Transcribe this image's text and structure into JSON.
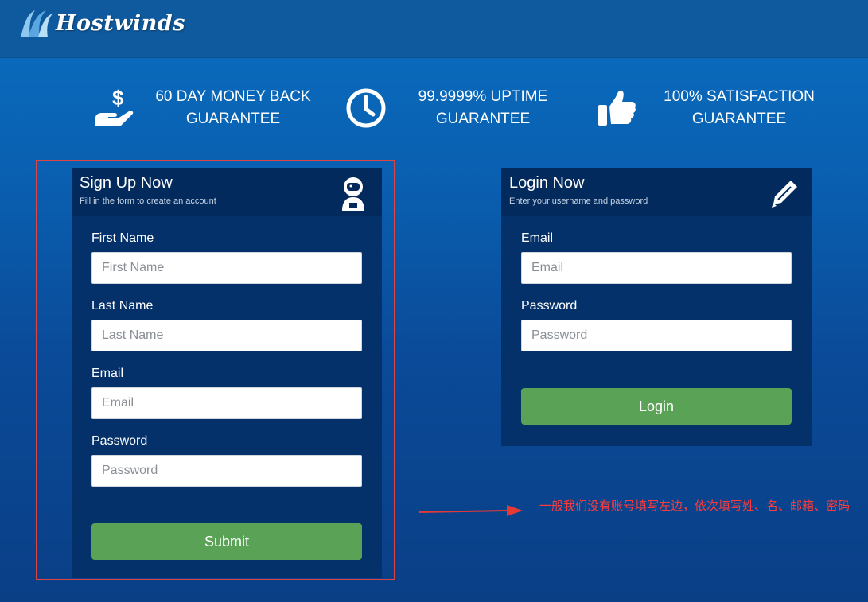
{
  "brand": {
    "name": "Hostwinds"
  },
  "features": [
    {
      "icon": "hand-dollar-icon",
      "line1": "60 DAY MONEY BACK",
      "line2": "GUARANTEE"
    },
    {
      "icon": "clock-icon",
      "line1": "99.9999% UPTIME",
      "line2": "GUARANTEE"
    },
    {
      "icon": "thumbs-up-icon",
      "line1": "100% SATISFACTION",
      "line2": "GUARANTEE"
    }
  ],
  "signup": {
    "title": "Sign Up Now",
    "subtitle": "Fill in the form to create an account",
    "icon": "astronaut-icon",
    "fields": {
      "first_name": {
        "label": "First Name",
        "placeholder": "First Name",
        "value": ""
      },
      "last_name": {
        "label": "Last Name",
        "placeholder": "Last Name",
        "value": ""
      },
      "email": {
        "label": "Email",
        "placeholder": "Email",
        "value": ""
      },
      "password": {
        "label": "Password",
        "placeholder": "Password",
        "value": ""
      }
    },
    "submit_label": "Submit"
  },
  "login": {
    "title": "Login Now",
    "subtitle": "Enter your username and password",
    "icon": "pencil-icon",
    "fields": {
      "email": {
        "label": "Email",
        "placeholder": "Email",
        "value": ""
      },
      "password": {
        "label": "Password",
        "placeholder": "Password",
        "value": ""
      }
    },
    "submit_label": "Login"
  },
  "annotation": {
    "text": "一般我们没有账号填写左边，依次填写姓、名、邮箱、密码"
  },
  "colors": {
    "accent_green": "#5aa255",
    "panel_bg": "#04316a",
    "annotation_red": "#ff3b3b"
  }
}
